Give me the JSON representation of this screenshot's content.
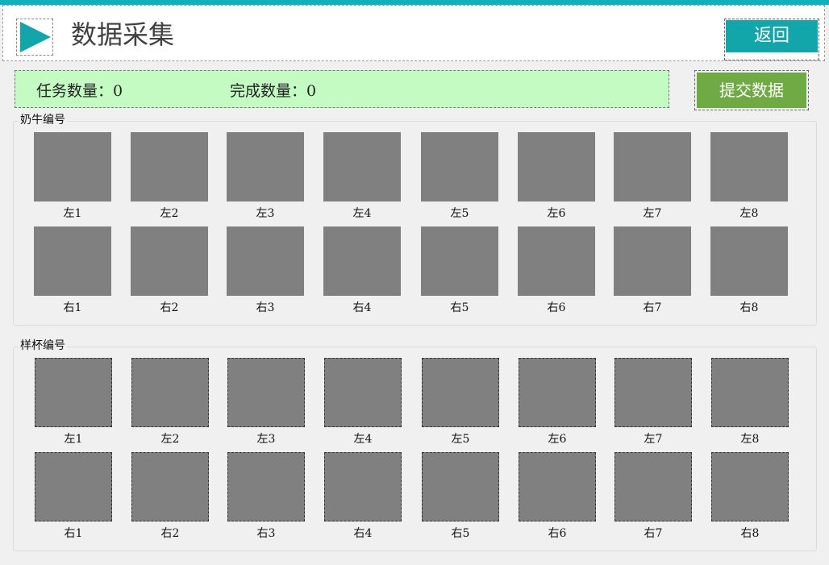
{
  "header": {
    "title": "数据采集",
    "back_label": "返回",
    "icon": "play-triangle-icon"
  },
  "status": {
    "task_count_label": "任务数量：0",
    "done_count_label": "完成数量：0"
  },
  "submit_label": "提交数据",
  "cow_section": {
    "title": "奶牛编号",
    "rows": [
      [
        "左1",
        "左2",
        "左3",
        "左4",
        "左5",
        "左6",
        "左7",
        "左8"
      ],
      [
        "右1",
        "右2",
        "右3",
        "右4",
        "右5",
        "右6",
        "右7",
        "右8"
      ]
    ]
  },
  "cup_section": {
    "title": "样杯编号",
    "rows": [
      [
        "左1",
        "左2",
        "左3",
        "左4",
        "左5",
        "左6",
        "左7",
        "左8"
      ],
      [
        "右1",
        "右2",
        "右3",
        "右4",
        "右5",
        "右6",
        "右7",
        "右8"
      ]
    ]
  },
  "colors": {
    "accent": "#12a5aa",
    "submit": "#70aa44",
    "status_bg": "#c3fbc3",
    "slot": "#808080"
  }
}
